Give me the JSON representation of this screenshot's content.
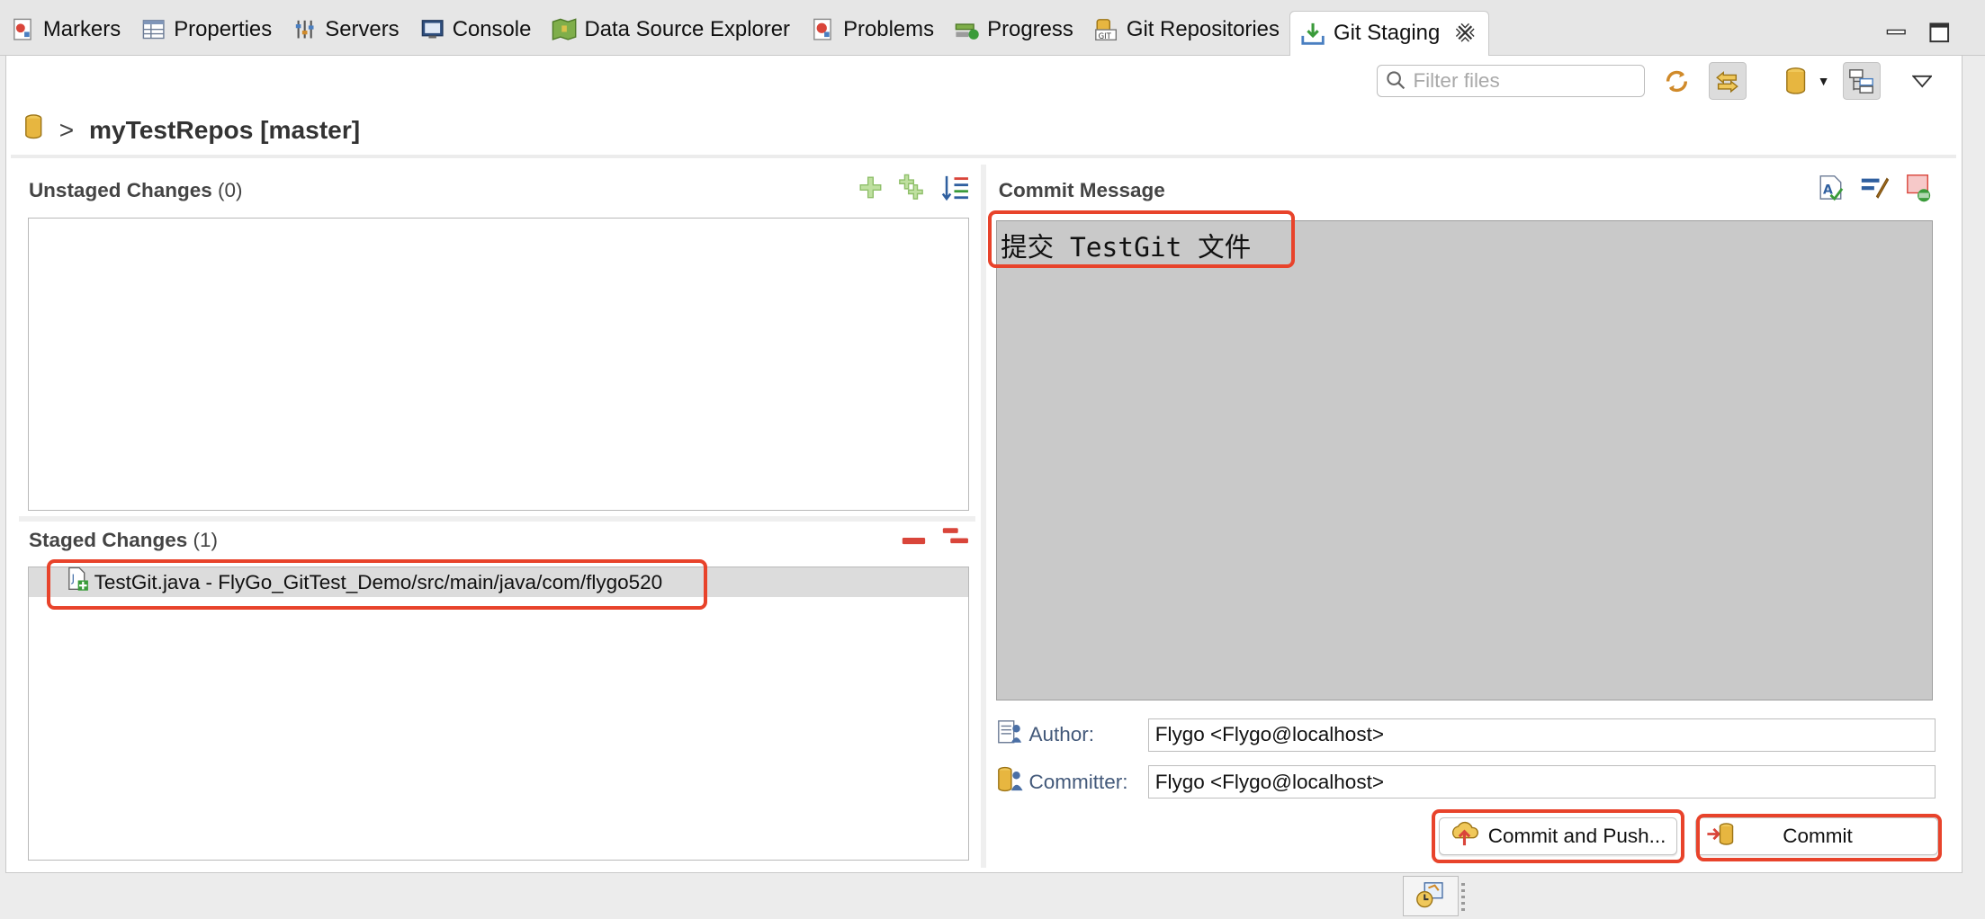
{
  "tabs": [
    {
      "label": "Markers",
      "icon": "markers-icon"
    },
    {
      "label": "Properties",
      "icon": "properties-icon"
    },
    {
      "label": "Servers",
      "icon": "servers-icon"
    },
    {
      "label": "Console",
      "icon": "console-icon"
    },
    {
      "label": "Data Source Explorer",
      "icon": "data-source-icon"
    },
    {
      "label": "Problems",
      "icon": "problems-icon"
    },
    {
      "label": "Progress",
      "icon": "progress-icon"
    },
    {
      "label": "Git Repositories",
      "icon": "git-repositories-icon"
    },
    {
      "label": "Git Staging",
      "icon": "git-staging-icon",
      "active": true
    }
  ],
  "toolbar": {
    "filter_placeholder": "Filter files"
  },
  "repo": {
    "chevron": ">",
    "name": "myTestRepos [master]"
  },
  "unstaged": {
    "title": "Unstaged Changes",
    "count": "(0)",
    "files": []
  },
  "staged": {
    "title": "Staged Changes",
    "count": "(1)",
    "files": [
      {
        "label": "TestGit.java - FlyGo_GitTest_Demo/src/main/java/com/flygo520"
      }
    ]
  },
  "commit": {
    "title": "Commit Message",
    "message": "提交 TestGit 文件",
    "author_label": "Author:",
    "author_value": "Flygo <Flygo@localhost>",
    "committer_label": "Committer:",
    "committer_value": "Flygo <Flygo@localhost>",
    "commit_and_push_label": "Commit and Push...",
    "commit_label": "Commit"
  },
  "colors": {
    "highlight": "#e8432b",
    "message_bg": "#c9c9c9",
    "selected_row": "#dcdcdc"
  }
}
